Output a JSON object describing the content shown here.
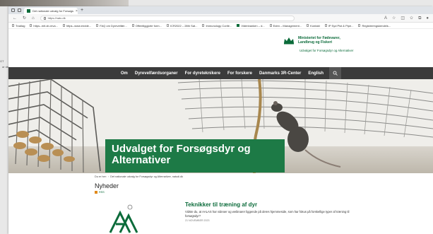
{
  "side_text": [
    "GT",
    "ar de"
  ],
  "browser": {
    "tab_title": "Det nationale udvalg for Forsøgs",
    "new_tab": "+",
    "url": "https://natu.dk",
    "bookmarks": [
      "Tradlag",
      "https--mit.ob-mva...",
      "https--www.endde...",
      "FAQ om Dyrevelfær...",
      "Offentliggjorte form...",
      "ICR2022 – 28th Sat...",
      "Immunology Confe...",
      "Videnbanken – d...",
      "Eden – Management...",
      "Kontakt",
      "IP Syd Pist & Pipe...",
      "Registreringskendels..."
    ]
  },
  "ministry": {
    "name": "Ministeriet for Fødevarer, Landbrug og Fiskeri",
    "unit": "Udvalget for Forsøgsdyr og Alternativer"
  },
  "nav": {
    "items": [
      "Om",
      "Dyrevelfærdsorganer",
      "For dyreteknikere",
      "For forskere",
      "Danmarks 3R-Center",
      "English"
    ]
  },
  "hero": {
    "title": "Udvalget for Forsøgsdyr og Alternativer"
  },
  "breadcrumb": {
    "prefix": "Du er her:",
    "current": "Det nationale udvalg for Forsøgsdyr og Alternativer, natudi.dk"
  },
  "news": {
    "heading": "Nyheder",
    "rss": "RSS"
  },
  "article": {
    "title": "Teknikker til træning af dyr",
    "text": "Vidste du, at AALAS har videoer og webinarer liggende på deres hjemmeside, som har fokus på forskellige typer af træning til forsøgsdyr?",
    "date": "21 NOVEMBER 2023"
  },
  "colors": {
    "brand_green": "#1d7a46",
    "nav_bg": "#3b3b3b"
  }
}
